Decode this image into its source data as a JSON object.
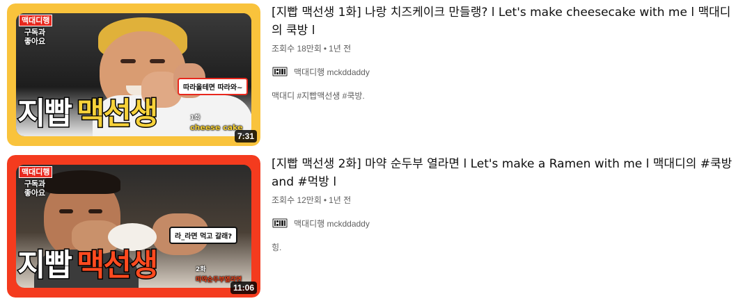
{
  "colors": {
    "v1_frame": "#f9c33c",
    "v2_frame": "#f43b1e",
    "title_highlight_v1": "#f7d23a",
    "title_highlight_v2": "#ff4a1f",
    "meta_text": "#606060"
  },
  "videos": [
    {
      "title": "[지빱 맥선생 1화] 나랑 치즈케이크 만들랭? l Let's make cheesecake with me l 맥대디의 쿡방 l",
      "views": "조회수 18만회",
      "age": "1년 전",
      "channel_name": "맥대디행 mckddaddy",
      "channel_icon": "mckddaddy-logo-icon",
      "description": "맥대디 #지빱맥선생 #쿡방.",
      "duration": "7:31",
      "thumb": {
        "tag_top": "맥대디행",
        "tag_bottom": "구독과 좋아요",
        "speech": "따라올테면 따라와~",
        "title_word1": "지빱",
        "title_word2": "맥선생",
        "ep": "1화",
        "sub": "cheese cake"
      }
    },
    {
      "title": "[지빱 맥선생 2화] 마약 순두부 열라면 l Let's make a Ramen with me l 맥대디의 #쿡방 and #먹방 l",
      "views": "조회수 12만회",
      "age": "1년 전",
      "channel_name": "맥대디행 mckddaddy",
      "channel_icon": "mckddaddy-logo-icon",
      "description": "힝.",
      "duration": "11:06",
      "thumb": {
        "tag_top": "맥대디행",
        "tag_bottom": "구독과 좋아요",
        "speech": "라_라면 먹고 갈래?",
        "title_word1": "지빱",
        "title_word2": "맥선생",
        "ep": "2화",
        "sub": "마약순두부열라면"
      }
    }
  ],
  "separator": "•"
}
